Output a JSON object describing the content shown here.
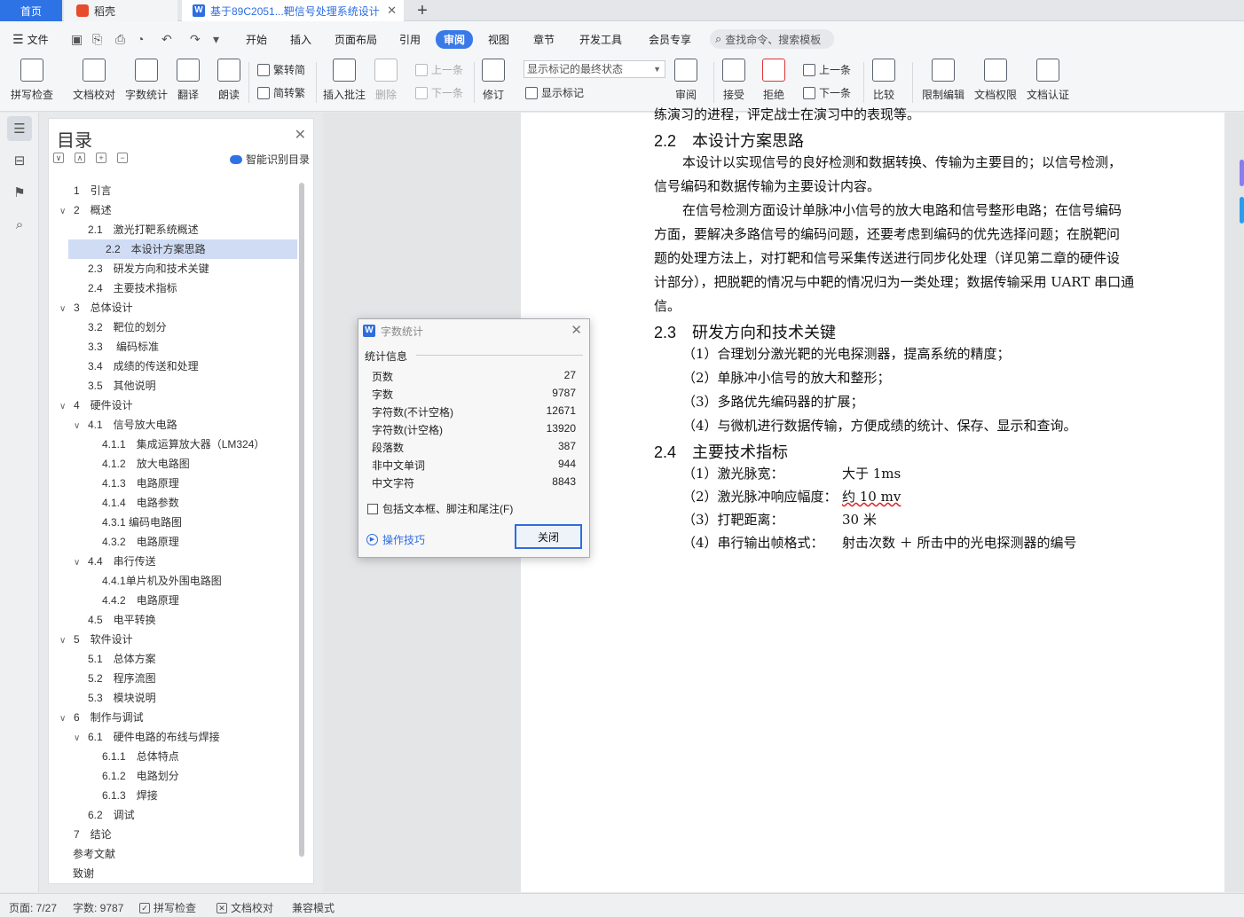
{
  "tabs": {
    "home": "首页",
    "docer": "稻壳",
    "doc": "基于89C2051...靶信号处理系统设计",
    "doc_close": "✕",
    "add": "+"
  },
  "menu": {
    "file": "文件",
    "items": [
      "开始",
      "插入",
      "页面布局",
      "引用",
      "审阅",
      "视图",
      "章节",
      "开发工具",
      "会员专享"
    ],
    "search": "查找命令、搜索模板"
  },
  "ribbon": {
    "spellcheck": "拼写检查",
    "doc_proof": "文档校对",
    "word_count": "字数统计",
    "translate": "翻译",
    "read_aloud": "朗读",
    "trad_to_simp": "繁转简",
    "simp_to_trad": "简转繁",
    "insert_comment": "插入批注",
    "delete": "删除",
    "prev": "上一条",
    "next": "下一条",
    "revise": "修订",
    "markup_state": "显示标记的最终状态",
    "show_markup": "显示标记",
    "review": "审阅",
    "accept": "接受",
    "reject": "拒绝",
    "prev2": "上一条",
    "next2": "下一条",
    "compare": "比较",
    "restrict_edit": "限制编辑",
    "doc_rights": "文档权限",
    "doc_auth": "文档认证"
  },
  "toc": {
    "title": "目录",
    "smart": "智能识别目录",
    "items": [
      {
        "label": "1　引言",
        "level": 0,
        "arrow": ""
      },
      {
        "label": "2　概述",
        "level": 0,
        "arrow": "∨"
      },
      {
        "label": "2.1　激光打靶系统概述",
        "level": 1,
        "arrow": ""
      },
      {
        "label": "2.2　本设计方案思路",
        "level": 1,
        "arrow": "",
        "selected": true
      },
      {
        "label": "2.3　研发方向和技术关键",
        "level": 1,
        "arrow": ""
      },
      {
        "label": "2.4　主要技术指标",
        "level": 1,
        "arrow": ""
      },
      {
        "label": "3　总体设计",
        "level": 0,
        "arrow": "∨"
      },
      {
        "label": "3.2　靶位的划分",
        "level": 1,
        "arrow": ""
      },
      {
        "label": "3.3　 编码标准",
        "level": 1,
        "arrow": ""
      },
      {
        "label": "3.4　成绩的传送和处理",
        "level": 1,
        "arrow": ""
      },
      {
        "label": "3.5　其他说明",
        "level": 1,
        "arrow": ""
      },
      {
        "label": "4　硬件设计",
        "level": 0,
        "arrow": "∨"
      },
      {
        "label": "4.1　信号放大电路",
        "level": 1,
        "arrow": "∨"
      },
      {
        "label": "4.1.1　集成运算放大器（LM324）",
        "level": 2,
        "arrow": ""
      },
      {
        "label": "4.1.2　放大电路图",
        "level": 2,
        "arrow": ""
      },
      {
        "label": "4.1.3　电路原理",
        "level": 2,
        "arrow": ""
      },
      {
        "label": "4.1.4　电路参数",
        "level": 2,
        "arrow": ""
      },
      {
        "label": "4.3.1 编码电路图",
        "level": 2,
        "arrow": ""
      },
      {
        "label": "4.3.2　电路原理",
        "level": 2,
        "arrow": ""
      },
      {
        "label": "4.4　串行传送",
        "level": 1,
        "arrow": "∨"
      },
      {
        "label": "4.4.1单片机及外围电路图",
        "level": 2,
        "arrow": ""
      },
      {
        "label": "4.4.2　电路原理",
        "level": 2,
        "arrow": ""
      },
      {
        "label": "4.5　电平转换",
        "level": 1,
        "arrow": ""
      },
      {
        "label": "5　软件设计",
        "level": 0,
        "arrow": "∨"
      },
      {
        "label": "5.1　总体方案",
        "level": 1,
        "arrow": ""
      },
      {
        "label": "5.2　程序流图",
        "level": 1,
        "arrow": ""
      },
      {
        "label": "5.3　模块说明",
        "level": 1,
        "arrow": ""
      },
      {
        "label": "6　制作与调试",
        "level": 0,
        "arrow": "∨"
      },
      {
        "label": "6.1　硬件电路的布线与焊接",
        "level": 1,
        "arrow": "∨"
      },
      {
        "label": "6.1.1　总体特点",
        "level": 2,
        "arrow": ""
      },
      {
        "label": "6.1.2　电路划分",
        "level": 2,
        "arrow": ""
      },
      {
        "label": "6.1.3　焊接",
        "level": 2,
        "arrow": ""
      },
      {
        "label": "6.2　调试",
        "level": 1,
        "arrow": ""
      },
      {
        "label": "7　结论",
        "level": 0,
        "arrow": ""
      },
      {
        "label": "参考文献",
        "level": -1,
        "arrow": ""
      },
      {
        "label": "致谢",
        "level": -1,
        "arrow": ""
      }
    ]
  },
  "document": {
    "lines": [
      {
        "text": "练演习的进程，评定战士在演习中的表现等。",
        "type": "body",
        "indent": false
      },
      {
        "text": "2.2　本设计方案思路",
        "type": "heading"
      },
      {
        "text": "本设计以实现信号的良好检测和数据转换、传输为主要目的；以信号检测，",
        "type": "body",
        "indent": true
      },
      {
        "text": "信号编码和数据传输为主要设计内容。",
        "type": "body",
        "indent": false
      },
      {
        "text": "在信号检测方面设计单脉冲小信号的放大电路和信号整形电路；在信号编码",
        "type": "body",
        "indent": true
      },
      {
        "text": "方面，要解决多路信号的编码问题，还要考虑到编码的优先选择问题；在脱靶问",
        "type": "body",
        "indent": false
      },
      {
        "text": "题的处理方法上，对打靶和信号采集传送进行同步化处理（详见第二章的硬件设",
        "type": "body",
        "indent": false
      },
      {
        "text": "计部分），把脱靶的情况与中靶的情况归为一类处理；数据传输采用 UART 串口通",
        "type": "body",
        "indent": false
      },
      {
        "text": "信。",
        "type": "body",
        "indent": false
      },
      {
        "text": "2.3　研发方向和技术关键",
        "type": "heading"
      },
      {
        "text": "（1）合理划分激光靶的光电探测器，提高系统的精度；",
        "type": "body",
        "indent": true
      },
      {
        "text": "（2）单脉冲小信号的放大和整形；",
        "type": "body",
        "indent": true
      },
      {
        "text": "（3）多路优先编码器的扩展；",
        "type": "body",
        "indent": true
      },
      {
        "text": "（4）与微机进行数据传输，方便成绩的统计、保存、显示和查询。",
        "type": "body",
        "indent": true
      },
      {
        "text": "2.4　主要技术指标",
        "type": "heading"
      }
    ],
    "specs": [
      {
        "label": "（1）激光脉宽：",
        "value": "大于 1ms"
      },
      {
        "label": "（2）激光脉冲响应幅度：",
        "value": "约 10 mv"
      },
      {
        "label": "（3）打靶距离：",
        "value": "30 米"
      },
      {
        "label": "（4）串行输出帧格式：",
        "value": "射击次数 ＋ 所击中的光电探测器的编号"
      }
    ]
  },
  "dialog": {
    "title": "字数统计",
    "section": "统计信息",
    "stats": [
      {
        "label": "页数",
        "value": "27"
      },
      {
        "label": "字数",
        "value": "9787"
      },
      {
        "label": "字符数(不计空格)",
        "value": "12671"
      },
      {
        "label": "字符数(计空格)",
        "value": "13920"
      },
      {
        "label": "段落数",
        "value": "387"
      },
      {
        "label": "非中文单词",
        "value": "944"
      },
      {
        "label": "中文字符",
        "value": "8843"
      }
    ],
    "include_label": "包括文本框、脚注和尾注(F)",
    "tips": "操作技巧",
    "close": "关闭"
  },
  "status": {
    "page": "页面: 7/27",
    "words": "字数: 9787",
    "spell": "拼写检查",
    "proof": "文档校对",
    "compat": "兼容模式"
  }
}
